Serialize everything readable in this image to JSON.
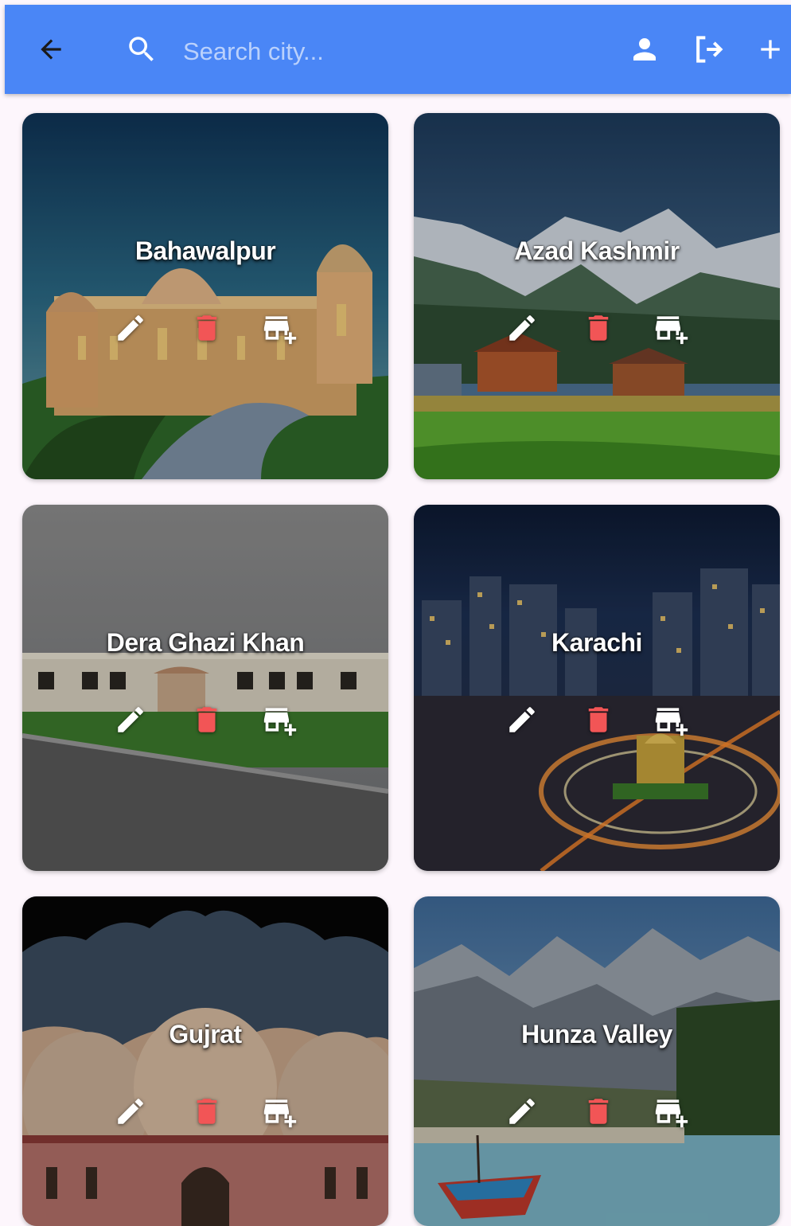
{
  "appbar": {
    "background": "#4a86f6",
    "back_icon": "arrow-back-icon",
    "search_icon": "search-icon",
    "search_placeholder": "Search city...",
    "profile_icon": "person-icon",
    "logout_icon": "logout-icon",
    "add_icon": "add-icon"
  },
  "cards": [
    {
      "name": "Bahawalpur"
    },
    {
      "name": "Azad Kashmir"
    },
    {
      "name": "Dera Ghazi Khan"
    },
    {
      "name": "Karachi"
    },
    {
      "name": "Gujrat"
    },
    {
      "name": "Hunza Valley"
    }
  ],
  "card_actions": {
    "edit_icon": "edit-icon",
    "delete_icon": "delete-icon",
    "add_store_icon": "add-business-icon",
    "delete_color": "#f25556"
  }
}
